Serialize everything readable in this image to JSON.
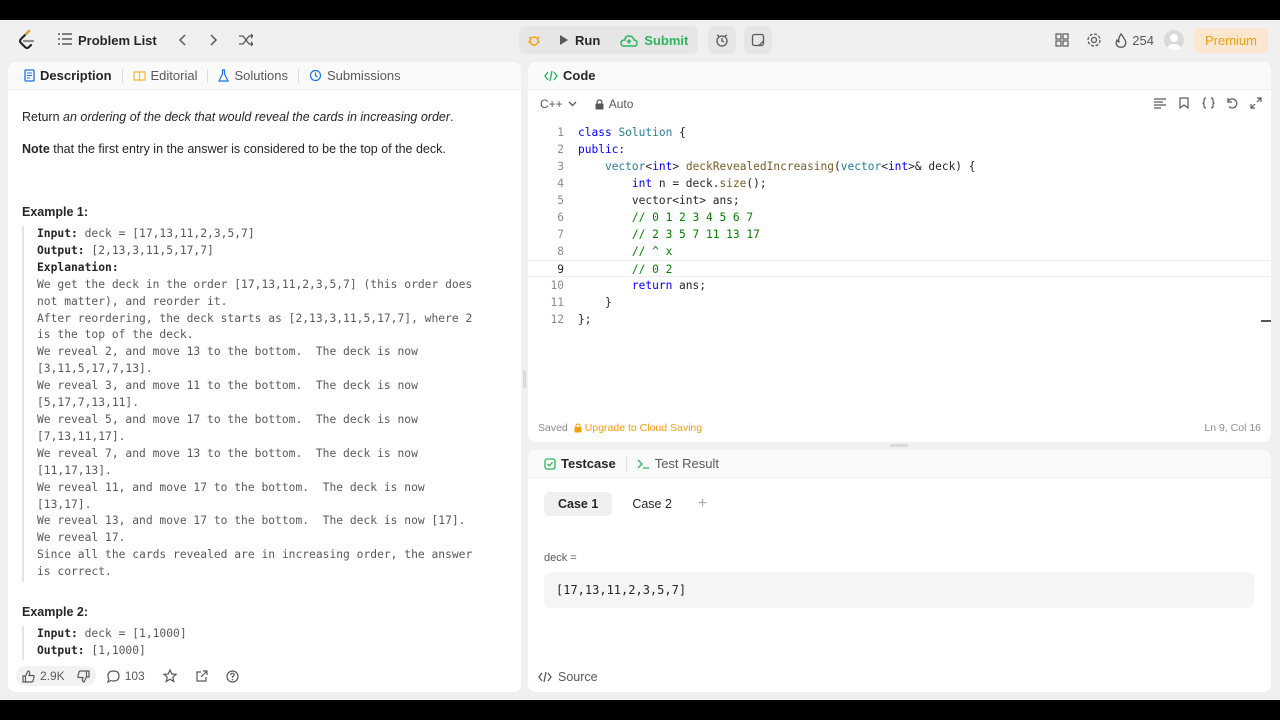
{
  "topbar": {
    "problem_list": "Problem List",
    "run": "Run",
    "submit": "Submit",
    "streak": "254",
    "premium": "Premium"
  },
  "left": {
    "tabs": [
      "Description",
      "Editorial",
      "Solutions",
      "Submissions"
    ],
    "return_prefix": "Return ",
    "return_em": "an ordering of the deck that would reveal the cards in increasing order",
    "return_suffix": ".",
    "note_bold": "Note",
    "note_rest": " that the first entry in the answer is considered to be the top of the deck.",
    "example1_title": "Example 1:",
    "example1": {
      "input_label": "Input:",
      "input": " deck = [17,13,11,2,3,5,7]",
      "output_label": "Output:",
      "output": " [2,13,3,11,5,17,7]",
      "explanation_label": "Explanation:",
      "explanation_lines": [
        "We get the deck in the order [17,13,11,2,3,5,7] (this order does",
        "not matter), and reorder it.",
        "After reordering, the deck starts as [2,13,3,11,5,17,7], where 2",
        "is the top of the deck.",
        "We reveal 2, and move 13 to the bottom.  The deck is now",
        "[3,11,5,17,7,13].",
        "We reveal 3, and move 11 to the bottom.  The deck is now",
        "[5,17,7,13,11].",
        "We reveal 5, and move 17 to the bottom.  The deck is now",
        "[7,13,11,17].",
        "We reveal 7, and move 13 to the bottom.  The deck is now",
        "[11,17,13].",
        "We reveal 11, and move 17 to the bottom.  The deck is now",
        "[13,17].",
        "We reveal 13, and move 17 to the bottom.  The deck is now [17].",
        "We reveal 17.",
        "Since all the cards revealed are in increasing order, the answer",
        "is correct."
      ]
    },
    "example2_title": "Example 2:",
    "example2": {
      "input_label": "Input:",
      "input": " deck = [1,1000]",
      "output_label": "Output:",
      "output": " [1,1000]"
    },
    "likes": "2.9K",
    "comments": "103"
  },
  "code": {
    "title": "Code",
    "language": "C++",
    "mode": "Auto",
    "line_numbers": [
      "1",
      "2",
      "3",
      "4",
      "5",
      "6",
      "7",
      "8",
      "9",
      "10",
      "11",
      "12"
    ],
    "status_saved": "Saved",
    "status_upgrade": "Upgrade to Cloud Saving",
    "cursor": "Ln 9, Col 16",
    "tokens": {
      "l1_kw": "class",
      "l1_cls": "Solution",
      "l1_rest": " {",
      "l2": "public:",
      "l3_t1": "vector",
      "l3_t2": "<",
      "l3_t3": "int",
      "l3_t4": "> ",
      "l3_fn": "deckRevealedIncreasing",
      "l3_p1": "(",
      "l3_t5": "vector",
      "l3_t6": "<",
      "l3_t7": "int",
      "l3_t8": ">& deck) {",
      "l4_kw": "int",
      "l4_rest1": " n = deck.",
      "l4_fn": "size",
      "l4_rest2": "();",
      "l5": "vector<int> ans;",
      "l6": "// 0 1 2 3 4 5 6 7",
      "l7": "// 2 3 5 7 11 13 17",
      "l8": "// ^ x",
      "l9": "// 0 2",
      "l10_kw": "return",
      "l10_rest": " ans;",
      "l11": "}",
      "l12": "};"
    }
  },
  "test": {
    "tab_testcase": "Testcase",
    "tab_result": "Test Result",
    "cases": [
      "Case 1",
      "Case 2"
    ],
    "field_label": "deck =",
    "field_value": "[17,13,11,2,3,5,7]",
    "source": "Source"
  }
}
